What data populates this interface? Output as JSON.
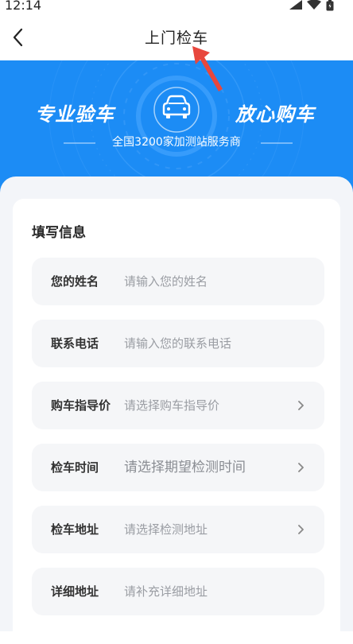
{
  "status_bar": {
    "time": "12:14",
    "icons": [
      "signal-icon",
      "wifi-icon",
      "battery-icon"
    ]
  },
  "nav": {
    "title": "上门检车",
    "back_icon": "back-arrow-icon"
  },
  "banner": {
    "left_text": "专业验车",
    "right_text": "放心购车",
    "subtitle": "全国3200家加测站服务商",
    "icon": "car-icon",
    "color": "#1c8cf5"
  },
  "form": {
    "title": "填写信息",
    "fields": [
      {
        "label": "您的姓名",
        "placeholder": "请输入您的姓名",
        "type": "input"
      },
      {
        "label": "联系电话",
        "placeholder": "请输入您的联系电话",
        "type": "input"
      },
      {
        "label": "购车指导价",
        "placeholder": "请选择购车指导价",
        "type": "select"
      },
      {
        "label": "检车时间",
        "placeholder": "请选择期望检测时间",
        "type": "select"
      },
      {
        "label": "检车地址",
        "placeholder": "请选择检测地址",
        "type": "select"
      },
      {
        "label": "详细地址",
        "placeholder": "请补充详细地址",
        "type": "input"
      }
    ]
  },
  "annotation": {
    "icon": "red-pointer-arrow-icon",
    "color": "#e8473d"
  }
}
